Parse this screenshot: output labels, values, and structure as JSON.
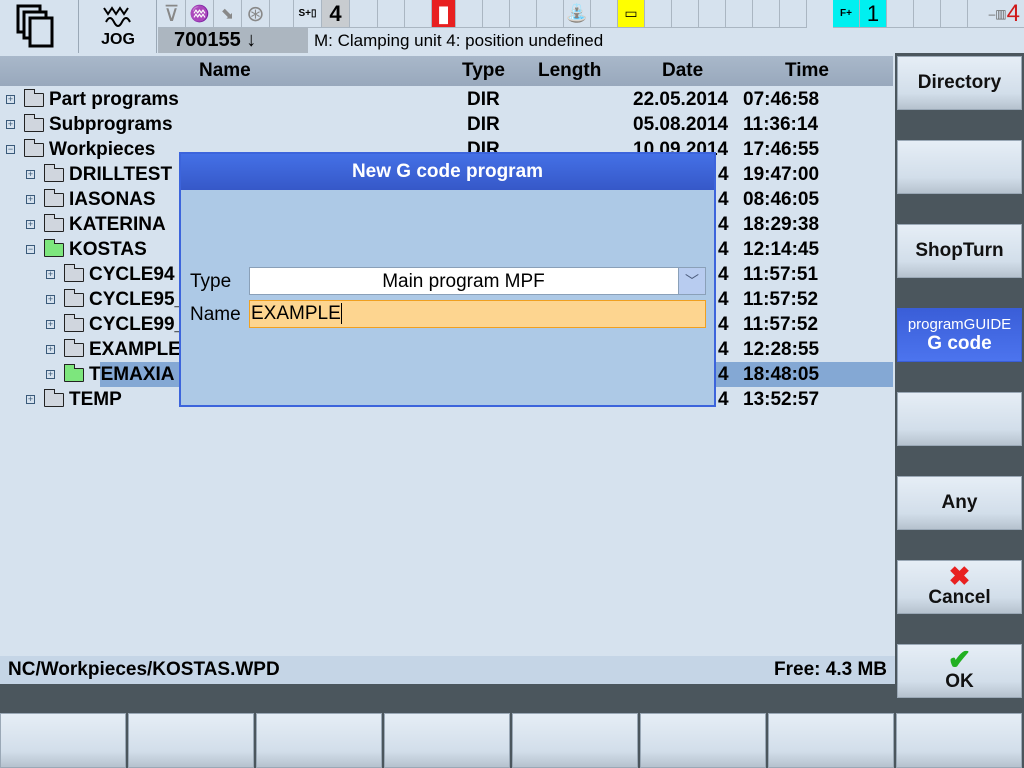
{
  "topbar": {
    "mode": "JOG",
    "program_number": "700155",
    "message": "M: Clamping unit 4: position undefined",
    "spindle_number": "4",
    "feed_number": "1",
    "channel_number": "4",
    "icons": [
      "window-switch-icon",
      "jog-mode-icon",
      "stop-icon",
      "reset-icon",
      "feed-icon",
      "handwheel-icon",
      "spindle-icon",
      "door-alarm-icon",
      "coolant-icon",
      "tool-icon",
      "feed-override-icon",
      "channel-icon"
    ]
  },
  "table": {
    "headers": {
      "name": "Name",
      "type": "Type",
      "length": "Length",
      "date": "Date",
      "time": "Time"
    },
    "rows": [
      {
        "name": "Part programs",
        "type": "DIR",
        "date": "22.05.2014",
        "time": "07:46:58",
        "level": 0,
        "expanded": false
      },
      {
        "name": "Subprograms",
        "type": "DIR",
        "date": "05.08.2014",
        "time": "11:36:14",
        "level": 0,
        "expanded": false
      },
      {
        "name": "Workpieces",
        "type": "DIR",
        "date": "10.09.2014",
        "time": "17:46:55",
        "level": 0,
        "expanded": true
      },
      {
        "name": "DRILLTEST",
        "date_tail": "4",
        "time": "19:47:00",
        "level": 1
      },
      {
        "name": "IASONAS",
        "date_tail": "4",
        "time": "08:46:05",
        "level": 1
      },
      {
        "name": "KATERINA",
        "date_tail": "4",
        "time": "18:29:38",
        "level": 1
      },
      {
        "name": "KOSTAS",
        "date_tail": "4",
        "time": "12:14:45",
        "level": 1,
        "expanded": true,
        "green": true
      },
      {
        "name": "CYCLE94",
        "date_tail": "4",
        "time": "11:57:51",
        "level": 2
      },
      {
        "name": "CYCLE95_",
        "date_tail": "4",
        "time": "11:57:52",
        "level": 2
      },
      {
        "name": "CYCLE99_",
        "date_tail": "4",
        "time": "11:57:52",
        "level": 2
      },
      {
        "name": "EXAMPLE",
        "date_tail": "4",
        "time": "12:28:55",
        "level": 2
      },
      {
        "name": "TEMAXIA",
        "date_tail": "4",
        "time": "18:48:05",
        "level": 2,
        "selected": true,
        "green": true
      },
      {
        "name": "TEMP",
        "date_tail": "4",
        "time": "13:52:57",
        "level": 1
      }
    ]
  },
  "status": {
    "path": "NC/Workpieces/KOSTAS.WPD",
    "free": "Free: 4.3 MB"
  },
  "dialog": {
    "title": "New G code program",
    "type_label": "Type",
    "type_value": "Main program MPF",
    "name_label": "Name",
    "name_value": "EXAMPLE"
  },
  "softkeys": {
    "directory": "Directory",
    "shopturn": "ShopTurn",
    "programguide_line1": "programGUIDE",
    "programguide_line2": "G code",
    "any": "Any",
    "cancel": "Cancel",
    "ok": "OK"
  },
  "colors": {
    "accent": "#3c64dc",
    "selected": "#84a8d4",
    "input_active": "#fdd590"
  }
}
